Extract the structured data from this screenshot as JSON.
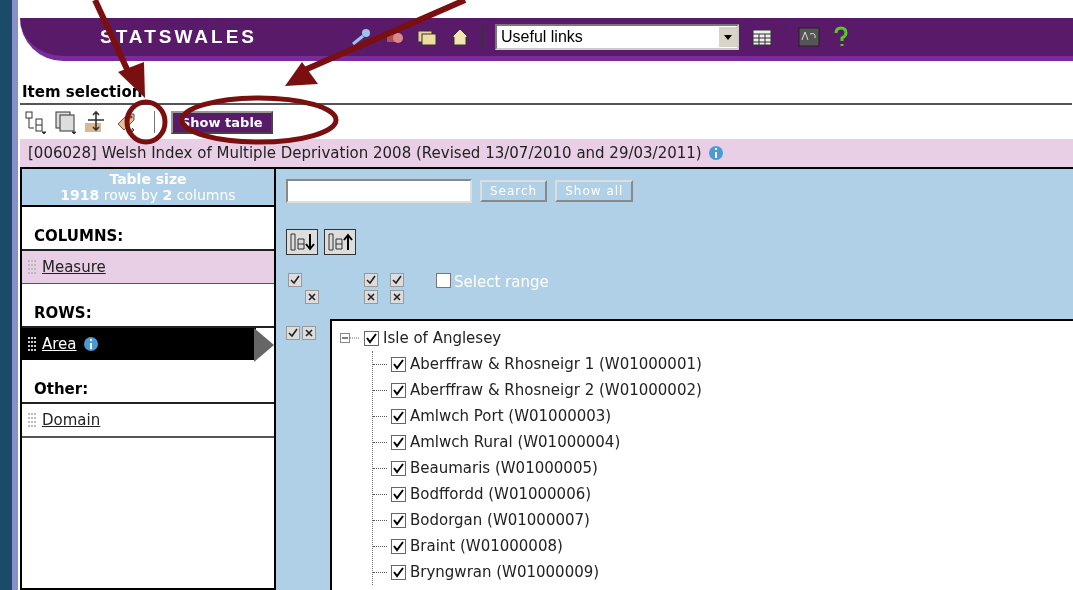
{
  "header": {
    "logo": "STATSWALES",
    "links_dropdown": {
      "value": "Useful links"
    }
  },
  "section_title": "Item selection",
  "toolbar": {
    "show_table_button": "Show table"
  },
  "dataset_title": "[006028] Welsh Index of Multiple Deprivation 2008 (Revised 13/07/2010 and 29/03/2011)",
  "table_size": {
    "title": "Table size",
    "rows": "1918",
    "rows_label": "rows by",
    "columns": "2",
    "columns_label": "columns"
  },
  "dimension_groups": [
    {
      "heading": "COLUMNS:",
      "items": [
        {
          "label": "Measure",
          "selected": false,
          "highlighted": true,
          "info": false
        }
      ]
    },
    {
      "heading": "ROWS:",
      "items": [
        {
          "label": "Area",
          "selected": true,
          "highlighted": false,
          "info": true
        }
      ]
    },
    {
      "heading": "Other:",
      "items": [
        {
          "label": "Domain",
          "selected": false,
          "highlighted": false,
          "info": false
        }
      ]
    }
  ],
  "search": {
    "buttons": [
      "Search",
      "Show all"
    ]
  },
  "select_range": {
    "label": "Select range",
    "checked": false
  },
  "tree": [
    {
      "label": "Isle of Anglesey",
      "checked": true,
      "expanded": true,
      "children": [
        {
          "label": "Aberffraw & Rhosneigr 1 (W01000001)",
          "checked": true
        },
        {
          "label": "Aberffraw & Rhosneigr 2 (W01000002)",
          "checked": true
        },
        {
          "label": "Amlwch Port (W01000003)",
          "checked": true
        },
        {
          "label": "Amlwch Rural (W01000004)",
          "checked": true
        },
        {
          "label": "Beaumaris (W01000005)",
          "checked": true
        },
        {
          "label": "Bodffordd (W01000006)",
          "checked": true
        },
        {
          "label": "Bodorgan (W01000007)",
          "checked": true
        },
        {
          "label": "Braint (W01000008)",
          "checked": true
        },
        {
          "label": "Bryngwran (W01000009)",
          "checked": true
        }
      ]
    }
  ]
}
